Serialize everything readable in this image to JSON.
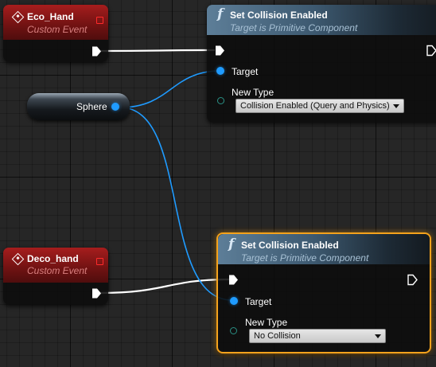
{
  "graph": {
    "events": [
      {
        "title": "Eco_Hand",
        "subtitle": "Custom Event",
        "icon": "event-diamond-icon",
        "color": "#a61d1d"
      },
      {
        "title": "Deco_hand",
        "subtitle": "Custom Event",
        "icon": "event-diamond-icon",
        "color": "#a61d1d"
      }
    ],
    "variable": {
      "label": "Sphere",
      "pin_color": "#1f9bff"
    },
    "functions": [
      {
        "title": "Set Collision Enabled",
        "subtitle": "Target is Primitive Component",
        "icon": "function-icon",
        "target_label": "Target",
        "new_type_label": "New Type",
        "new_type_value": "Collision Enabled (Query and Physics)",
        "selected": false
      },
      {
        "title": "Set Collision Enabled",
        "subtitle": "Target is Primitive Component",
        "icon": "function-icon",
        "target_label": "Target",
        "new_type_label": "New Type",
        "new_type_value": "No Collision",
        "selected": true,
        "selection_color": "#f4a21c"
      }
    ],
    "wire_colors": {
      "exec": "#ffffff",
      "object": "#1f9bff"
    }
  }
}
